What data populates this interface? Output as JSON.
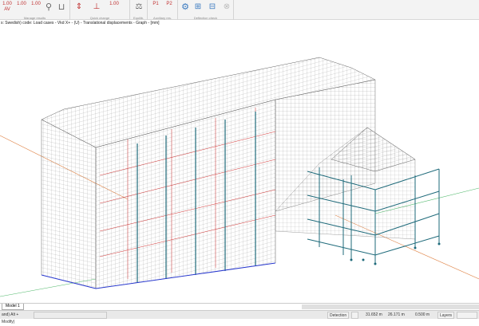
{
  "ribbon": {
    "groups": [
      {
        "label": "Manage results",
        "buttons": [
          {
            "text": "1.00 AV",
            "icon": "av-icon"
          },
          {
            "text": "1.00",
            "icon": "result-scale-icon"
          },
          {
            "text": "1.00",
            "icon": "result-grid-icon"
          },
          {
            "text": "",
            "icon": "zoom-search-icon"
          },
          {
            "text": "",
            "icon": "section-frame-icon"
          }
        ]
      },
      {
        "label": "Quick change",
        "buttons": [
          {
            "text": "",
            "icon": "load-arrow-icon"
          },
          {
            "text": "",
            "icon": "load-case-icon"
          },
          {
            "text": "1.00",
            "icon": "factor-icon"
          }
        ]
      },
      {
        "label": "Equilib.",
        "buttons": [
          {
            "text": "",
            "icon": "balance-icon"
          }
        ]
      },
      {
        "label": "Auxiliary res.",
        "buttons": [
          {
            "text": "P1",
            "icon": "aux-p1-icon"
          },
          {
            "text": "P2",
            "icon": "aux-p2-icon"
          }
        ]
      },
      {
        "label": "Deflection check",
        "buttons": [
          {
            "text": "",
            "icon": "gear-icon"
          },
          {
            "text": "",
            "icon": "deflection-beam-icon"
          },
          {
            "text": "",
            "icon": "deflection-grid-icon"
          },
          {
            "text": "",
            "icon": "disabled-icon"
          }
        ]
      }
    ]
  },
  "info_line": "s: Swedish) code: Load cases - Vkd X+ - (U) - Translational displacements - Graph - [mm]",
  "tabs": [
    {
      "label": "Model 1"
    }
  ],
  "status": {
    "left_hint": "and) Alt + Modify)",
    "detection": "Detection",
    "x": "31.652 m",
    "y": "26.171 m",
    "z": "0.500 m",
    "layers": "Layers"
  },
  "colors": {
    "mesh": "#8a8a8a",
    "red_line": "#d03030",
    "teal_member": "#1e6a7a",
    "axis_orange": "#e0864a",
    "axis_green": "#4fb86a",
    "blue_edge": "#2a3ad0"
  }
}
